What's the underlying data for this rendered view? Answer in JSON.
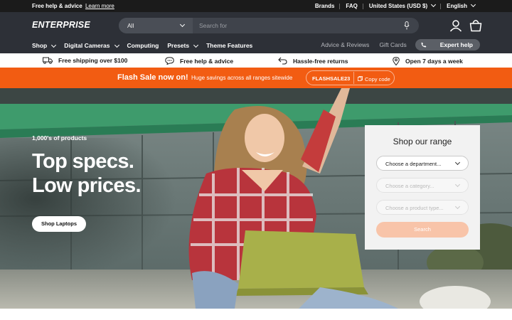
{
  "topbar": {
    "help_text": "Free help & advice",
    "help_link": "Learn more",
    "links": [
      "Brands",
      "FAQ",
      "United States (USD $)",
      "English"
    ]
  },
  "header": {
    "logo": "ENTERPRISE",
    "search": {
      "category": "All",
      "placeholder": "Search for"
    },
    "icons": [
      "mic-icon",
      "user-icon",
      "shopping-bag-icon"
    ]
  },
  "nav": {
    "items": [
      {
        "label": "Shop",
        "dropdown": true
      },
      {
        "label": "Digital Cameras",
        "dropdown": true
      },
      {
        "label": "Computing",
        "dropdown": false
      },
      {
        "label": "Presets",
        "dropdown": true
      },
      {
        "label": "Theme Features",
        "dropdown": false
      }
    ],
    "right": [
      "Advice & Reviews",
      "Gift Cards"
    ],
    "expert_label": "Expert help"
  },
  "usp": {
    "items": [
      {
        "icon": "truck-icon",
        "label": "Free shipping over $100"
      },
      {
        "icon": "chat-icon",
        "label": "Free help & advice"
      },
      {
        "icon": "return-arrow-icon",
        "label": "Hassle-free returns"
      },
      {
        "icon": "location-pin-icon",
        "label": "Open 7 days a week"
      }
    ]
  },
  "flash": {
    "title": "Flash Sale now on!",
    "subtitle": "Huge savings across all ranges sitewide",
    "code": "FLASHSALE23",
    "copy_label": "Copy code"
  },
  "hero": {
    "count": "1,000's of products",
    "headline_line1": "Top specs.",
    "headline_line2": "Low prices.",
    "cta": "Shop Laptops"
  },
  "range": {
    "title": "Shop our range",
    "department": "Choose a department...",
    "category": "Choose a category...",
    "product_type": "Choose a product type...",
    "search_label": "Search"
  },
  "colors": {
    "topbar": "#1b1b1b",
    "header": "#2d3037",
    "flash": "#f25c12",
    "search_button": "#f8c4a9"
  }
}
